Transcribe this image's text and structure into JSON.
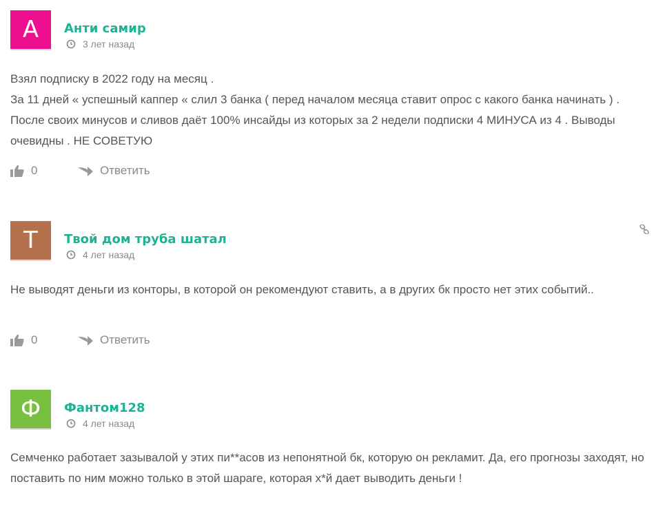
{
  "colors": {
    "author": "#1bb394",
    "text": "#555555",
    "muted": "#8a8a8a"
  },
  "comments": [
    {
      "avatar_letter": "А",
      "avatar_color": "#ee0e90",
      "author": "Анти самир",
      "time": "3 лет назад",
      "body": [
        "Взял подписку в 2022 году на месяц .",
        "За 11 дней « успешный каппер « слил 3 банка ( перед началом месяца ставит опрос с какого банка начинать ) . После своих минусов и сливов даёт 100% инсайды из которых за 2 недели подписки 4 МИНУСА из 4 . Выводы очевидны . НЕ СОВЕТУЮ"
      ],
      "likes": "0",
      "reply_label": "Ответить"
    },
    {
      "avatar_letter": "Т",
      "avatar_color": "#b5714b",
      "author": "Твой дом труба шатал",
      "time": "4 лет назад",
      "body": [
        "Не выводят деньги из конторы, в которой он рекомендуют ставить, а в других бк просто нет этих событий.."
      ],
      "likes": "0",
      "reply_label": "Ответить"
    },
    {
      "avatar_letter": "Ф",
      "avatar_color": "#78bf40",
      "author": "Фантом128",
      "time": "4 лет назад",
      "body": [
        "Семченко работает зазывалой у этих пи**асов из непонятной бк, которую он рекламит. Да, его прогнозы заходят, но поставить по ним можно только в этой шараге, которая х*й дает выводить деньги !"
      ]
    }
  ]
}
